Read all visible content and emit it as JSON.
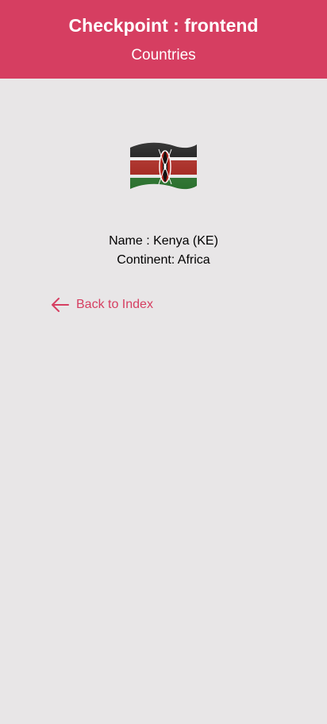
{
  "header": {
    "title": "Checkpoint : frontend",
    "subtitle": "Countries"
  },
  "country": {
    "flag_icon": "kenya-flag-icon",
    "name_line": "Name : Kenya (KE)",
    "continent_line": "Continent: Africa"
  },
  "nav": {
    "back_label": "Back to Index",
    "back_icon": "arrow-left-icon"
  },
  "colors": {
    "accent": "#d63e61",
    "background": "#e8e6e7",
    "header_text": "#ffffff"
  }
}
